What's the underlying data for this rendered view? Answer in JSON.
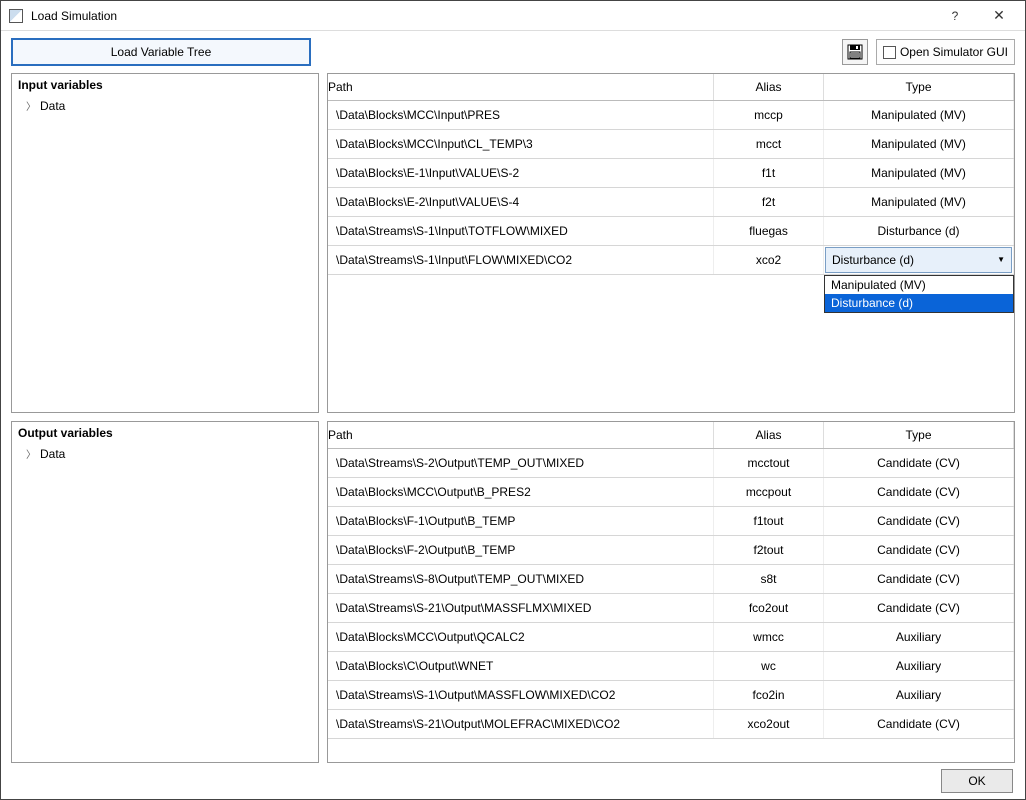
{
  "window": {
    "title": "Load Simulation",
    "help": "?",
    "close": "✕"
  },
  "toolbar": {
    "load_btn": "Load Variable Tree",
    "open_gui_label": "Open Simulator GUI"
  },
  "panels": {
    "input_title": "Input variables",
    "output_title": "Output variables",
    "tree_root": "Data"
  },
  "headers": {
    "path": "Path",
    "alias": "Alias",
    "type": "Type"
  },
  "input_rows": [
    {
      "path": "\\Data\\Blocks\\MCC\\Input\\PRES",
      "alias": "mccp",
      "type": "Manipulated (MV)"
    },
    {
      "path": "\\Data\\Blocks\\MCC\\Input\\CL_TEMP\\3",
      "alias": "mcct",
      "type": "Manipulated (MV)"
    },
    {
      "path": "\\Data\\Blocks\\E-1\\Input\\VALUE\\S-2",
      "alias": "f1t",
      "type": "Manipulated (MV)"
    },
    {
      "path": "\\Data\\Blocks\\E-2\\Input\\VALUE\\S-4",
      "alias": "f2t",
      "type": "Manipulated (MV)"
    },
    {
      "path": "\\Data\\Streams\\S-1\\Input\\TOTFLOW\\MIXED",
      "alias": "fluegas",
      "type": "Disturbance (d)"
    },
    {
      "path": "\\Data\\Streams\\S-1\\Input\\FLOW\\MIXED\\CO2",
      "alias": "xco2",
      "type": "Disturbance (d)",
      "combo": true
    }
  ],
  "dropdown": {
    "opt1": "Manipulated (MV)",
    "opt2": "Disturbance (d)"
  },
  "output_rows": [
    {
      "path": "\\Data\\Streams\\S-2\\Output\\TEMP_OUT\\MIXED",
      "alias": "mcctout",
      "type": "Candidate (CV)"
    },
    {
      "path": "\\Data\\Blocks\\MCC\\Output\\B_PRES2",
      "alias": "mccpout",
      "type": "Candidate (CV)"
    },
    {
      "path": "\\Data\\Blocks\\F-1\\Output\\B_TEMP",
      "alias": "f1tout",
      "type": "Candidate (CV)"
    },
    {
      "path": "\\Data\\Blocks\\F-2\\Output\\B_TEMP",
      "alias": "f2tout",
      "type": "Candidate (CV)"
    },
    {
      "path": "\\Data\\Streams\\S-8\\Output\\TEMP_OUT\\MIXED",
      "alias": "s8t",
      "type": "Candidate (CV)"
    },
    {
      "path": "\\Data\\Streams\\S-21\\Output\\MASSFLMX\\MIXED",
      "alias": "fco2out",
      "type": "Candidate (CV)"
    },
    {
      "path": "\\Data\\Blocks\\MCC\\Output\\QCALC2",
      "alias": "wmcc",
      "type": "Auxiliary"
    },
    {
      "path": "\\Data\\Blocks\\C\\Output\\WNET",
      "alias": "wc",
      "type": "Auxiliary"
    },
    {
      "path": "\\Data\\Streams\\S-1\\Output\\MASSFLOW\\MIXED\\CO2",
      "alias": "fco2in",
      "type": "Auxiliary"
    },
    {
      "path": "\\Data\\Streams\\S-21\\Output\\MOLEFRAC\\MIXED\\CO2",
      "alias": "xco2out",
      "type": "Candidate (CV)"
    }
  ],
  "footer": {
    "ok": "OK"
  }
}
